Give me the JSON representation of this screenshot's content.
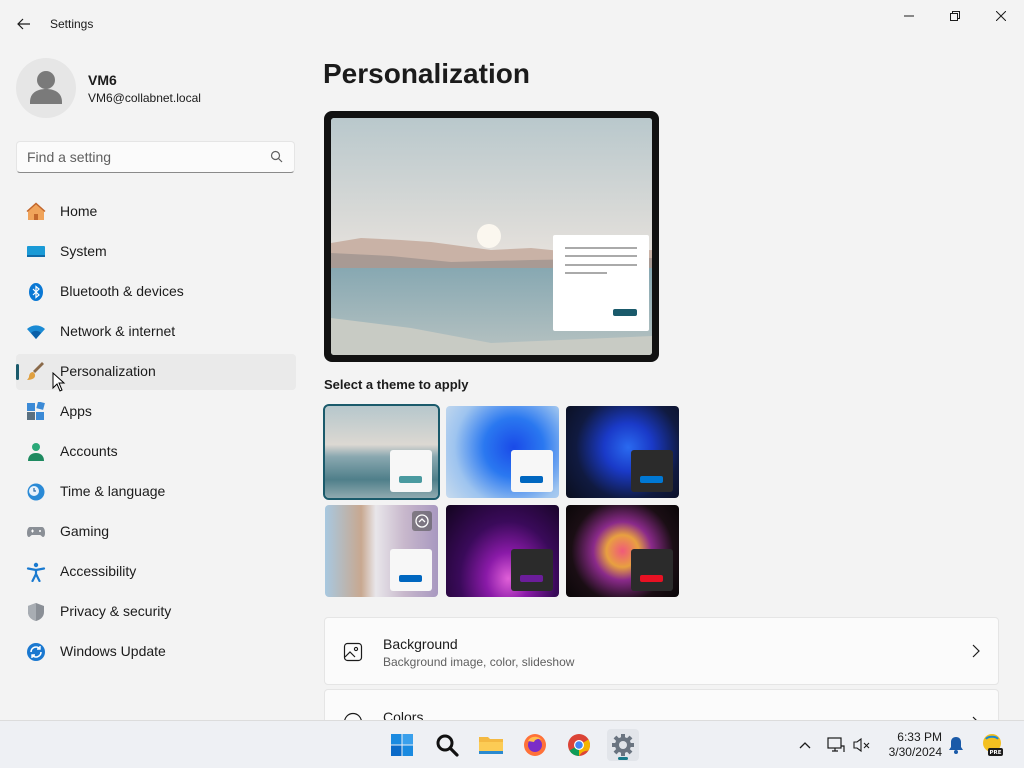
{
  "window": {
    "title": "Settings"
  },
  "user": {
    "name": "VM6",
    "email": "VM6@collabnet.local"
  },
  "search": {
    "placeholder": "Find a setting"
  },
  "nav": {
    "items": [
      {
        "label": "Home",
        "icon": "home-icon"
      },
      {
        "label": "System",
        "icon": "system-icon"
      },
      {
        "label": "Bluetooth & devices",
        "icon": "bluetooth-icon"
      },
      {
        "label": "Network & internet",
        "icon": "wifi-icon"
      },
      {
        "label": "Personalization",
        "icon": "brush-icon",
        "active": true
      },
      {
        "label": "Apps",
        "icon": "apps-icon"
      },
      {
        "label": "Accounts",
        "icon": "accounts-icon"
      },
      {
        "label": "Time & language",
        "icon": "clock-globe-icon"
      },
      {
        "label": "Gaming",
        "icon": "gamepad-icon"
      },
      {
        "label": "Accessibility",
        "icon": "accessibility-icon"
      },
      {
        "label": "Privacy & security",
        "icon": "shield-icon"
      },
      {
        "label": "Windows Update",
        "icon": "update-icon"
      }
    ]
  },
  "main": {
    "title": "Personalization",
    "theme_section_label": "Select a theme to apply",
    "themes": [
      {
        "name": "lake-light",
        "selected": true,
        "accent": "#4a9aa0"
      },
      {
        "name": "bloom-light",
        "accent": "#0067c0"
      },
      {
        "name": "bloom-dark",
        "accent": "#0078d4"
      },
      {
        "name": "flowers",
        "accent": "#0067c0"
      },
      {
        "name": "glow-dark",
        "accent": "#6b1d9a"
      },
      {
        "name": "captured-motion",
        "accent": "#e81123"
      }
    ],
    "cards": [
      {
        "title": "Background",
        "subtitle": "Background image, color, slideshow",
        "icon": "picture-icon"
      },
      {
        "title": "Colors",
        "subtitle": "",
        "icon": "palette-icon"
      }
    ]
  },
  "taskbar": {
    "apps": [
      "start-icon",
      "search-icon",
      "file-explorer-icon",
      "firefox-icon",
      "chrome-icon",
      "settings-icon"
    ],
    "time": "6:33 PM",
    "date": "3/30/2024"
  },
  "colors": {
    "accent": "#1a5a6b",
    "background": "#f3f3f3",
    "card": "#fbfbfb"
  }
}
